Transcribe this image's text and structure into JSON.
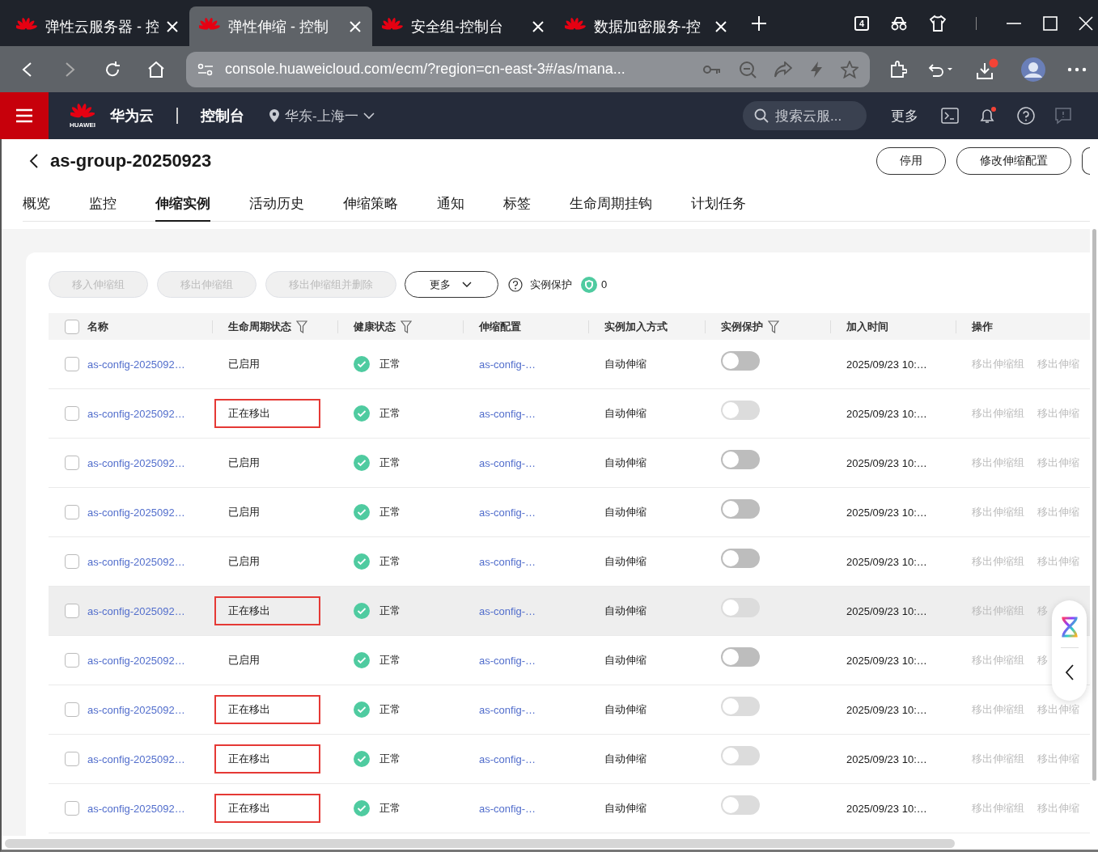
{
  "browser": {
    "tabs": [
      {
        "title": "弹性云服务器 - 控",
        "selected": false
      },
      {
        "title": "弹性伸缩 - 控制",
        "selected": true
      },
      {
        "title": "安全组-控制台",
        "selected": false
      },
      {
        "title": "数据加密服务-控",
        "selected": false
      }
    ],
    "tab_count": "4",
    "url": "console.huaweicloud.com/ecm/?region=cn-east-3#/as/mana..."
  },
  "console_header": {
    "logo_text": "HUAWEI",
    "brand": "华为云",
    "console": "控制台",
    "region": "华东-上海一",
    "search": {
      "placeholder": "搜索云服..."
    },
    "more": "更多"
  },
  "page": {
    "title": "as-group-20250923",
    "buttons": [
      "停用",
      "修改伸缩配置"
    ],
    "tabs": [
      {
        "label": "概览",
        "selected": false
      },
      {
        "label": "监控",
        "selected": false
      },
      {
        "label": "伸缩实例",
        "selected": true
      },
      {
        "label": "活动历史",
        "selected": false
      },
      {
        "label": "伸缩策略",
        "selected": false
      },
      {
        "label": "通知",
        "selected": false
      },
      {
        "label": "标签",
        "selected": false
      },
      {
        "label": "生命周期挂钩",
        "selected": false
      },
      {
        "label": "计划任务",
        "selected": false
      }
    ]
  },
  "toolbar": {
    "buttons": [
      {
        "label": "移入伸缩组",
        "disabled": true
      },
      {
        "label": "移出伸缩组",
        "disabled": true
      },
      {
        "label": "移出伸缩组并删除",
        "disabled": true
      }
    ],
    "more": "更多",
    "protection_label": "实例保护",
    "protection_count": "0"
  },
  "table": {
    "select_all_checked": false,
    "columns": [
      {
        "label": "名称",
        "filter": false
      },
      {
        "label": "生命周期状态",
        "filter": true
      },
      {
        "label": "健康状态",
        "filter": true
      },
      {
        "label": "伸缩配置",
        "filter": false
      },
      {
        "label": "实例加入方式",
        "filter": false
      },
      {
        "label": "实例保护",
        "filter": true
      },
      {
        "label": "加入时间",
        "filter": false
      },
      {
        "label": "操作",
        "filter": false
      }
    ],
    "rows": [
      {
        "checked": false,
        "hover": false,
        "name": "as-config-2025092…",
        "lifecycle": "已启用",
        "annotated": false,
        "health": "正常",
        "config": "as-config-…",
        "join_mode": "自动伸缩",
        "protection": {
          "on": false,
          "disabled": false
        },
        "join_time": "2025/09/23 10:…",
        "actions": [
          "移出伸缩组",
          "移出伸缩"
        ]
      },
      {
        "checked": false,
        "hover": false,
        "name": "as-config-2025092…",
        "lifecycle": "正在移出",
        "annotated": true,
        "health": "正常",
        "config": "as-config-…",
        "join_mode": "自动伸缩",
        "protection": {
          "on": false,
          "disabled": true
        },
        "join_time": "2025/09/23 10:…",
        "actions": [
          "移出伸缩组",
          "移出伸缩"
        ]
      },
      {
        "checked": false,
        "hover": false,
        "name": "as-config-2025092…",
        "lifecycle": "已启用",
        "annotated": false,
        "health": "正常",
        "config": "as-config-…",
        "join_mode": "自动伸缩",
        "protection": {
          "on": false,
          "disabled": false
        },
        "join_time": "2025/09/23 10:…",
        "actions": [
          "移出伸缩组",
          "移出伸缩"
        ]
      },
      {
        "checked": false,
        "hover": false,
        "name": "as-config-2025092…",
        "lifecycle": "已启用",
        "annotated": false,
        "health": "正常",
        "config": "as-config-…",
        "join_mode": "自动伸缩",
        "protection": {
          "on": false,
          "disabled": false
        },
        "join_time": "2025/09/23 10:…",
        "actions": [
          "移出伸缩组",
          "移出伸缩"
        ]
      },
      {
        "checked": false,
        "hover": false,
        "name": "as-config-2025092…",
        "lifecycle": "已启用",
        "annotated": false,
        "health": "正常",
        "config": "as-config-…",
        "join_mode": "自动伸缩",
        "protection": {
          "on": false,
          "disabled": false
        },
        "join_time": "2025/09/23 10:…",
        "actions": [
          "移出伸缩组",
          "移出伸缩"
        ]
      },
      {
        "checked": false,
        "hover": true,
        "name": "as-config-2025092…",
        "lifecycle": "正在移出",
        "annotated": true,
        "health": "正常",
        "config": "as-config-…",
        "join_mode": "自动伸缩",
        "protection": {
          "on": false,
          "disabled": true
        },
        "join_time": "2025/09/23 10:…",
        "actions": [
          "移出伸缩组",
          "移"
        ]
      },
      {
        "checked": false,
        "hover": false,
        "name": "as-config-2025092…",
        "lifecycle": "已启用",
        "annotated": false,
        "health": "正常",
        "config": "as-config-…",
        "join_mode": "自动伸缩",
        "protection": {
          "on": false,
          "disabled": false
        },
        "join_time": "2025/09/23 10:…",
        "actions": [
          "移出伸缩组",
          "移"
        ]
      },
      {
        "checked": false,
        "hover": false,
        "name": "as-config-2025092…",
        "lifecycle": "正在移出",
        "annotated": true,
        "health": "正常",
        "config": "as-config-…",
        "join_mode": "自动伸缩",
        "protection": {
          "on": false,
          "disabled": true
        },
        "join_time": "2025/09/23 10:…",
        "actions": [
          "移出伸缩组",
          "移出伸缩"
        ]
      },
      {
        "checked": false,
        "hover": false,
        "name": "as-config-2025092…",
        "lifecycle": "正在移出",
        "annotated": true,
        "health": "正常",
        "config": "as-config-…",
        "join_mode": "自动伸缩",
        "protection": {
          "on": false,
          "disabled": true
        },
        "join_time": "2025/09/23 10:…",
        "actions": [
          "移出伸缩组",
          "移出伸缩"
        ]
      },
      {
        "checked": false,
        "hover": false,
        "name": "as-config-2025092…",
        "lifecycle": "正在移出",
        "annotated": true,
        "health": "正常",
        "config": "as-config-…",
        "join_mode": "自动伸缩",
        "protection": {
          "on": false,
          "disabled": true
        },
        "join_time": "2025/09/23 10:…",
        "actions": [
          "移出伸缩组",
          "移出伸缩"
        ]
      }
    ]
  }
}
